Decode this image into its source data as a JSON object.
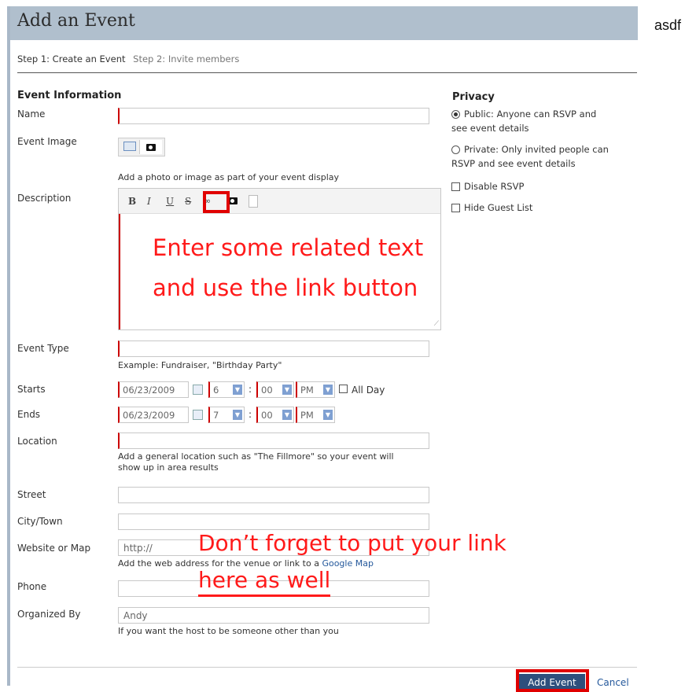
{
  "header": {
    "title": "Add an Event"
  },
  "side_text": "asdf",
  "steps": {
    "step1": "Step 1: Create an Event",
    "step2": "Step 2: Invite members"
  },
  "section": "Event Information",
  "fields": {
    "name": {
      "label": "Name",
      "value": ""
    },
    "event_image": {
      "label": "Event Image",
      "help": "Add a photo or image as part of your event display"
    },
    "description": {
      "label": "Description"
    },
    "event_type": {
      "label": "Event Type",
      "help": "Example: Fundraiser, \"Birthday Party\""
    },
    "starts": {
      "label": "Starts",
      "date": "06/23/2009",
      "hour": "6",
      "minute": "00",
      "ampm": "PM",
      "all_day": "All Day"
    },
    "ends": {
      "label": "Ends",
      "date": "06/23/2009",
      "hour": "7",
      "minute": "00",
      "ampm": "PM"
    },
    "location": {
      "label": "Location",
      "help_line1": "Add a general location such as \"The Fillmore\" so your event will",
      "help_line2": "show up in area results"
    },
    "street": {
      "label": "Street"
    },
    "city": {
      "label": "City/Town"
    },
    "website": {
      "label": "Website or Map",
      "value": "http://",
      "help": "Add the web address for the venue or link to a",
      "help_link": "Google Map"
    },
    "phone": {
      "label": "Phone"
    },
    "organized_by": {
      "label": "Organized By",
      "value": "Andy",
      "help": "If you want the host to be someone other than you"
    }
  },
  "toolbar": {
    "bold": "B",
    "italic": "I",
    "underline": "U",
    "strike": "S"
  },
  "privacy": {
    "title": "Privacy",
    "public_line1": "Public: Anyone can RSVP and",
    "public_line2": "see event details",
    "private_line1": "Private: Only invited people can",
    "private_line2": "RSVP and see event details",
    "disable_rsvp": "Disable RSVP",
    "hide_guest_list": "Hide Guest List"
  },
  "annotations": {
    "editor_line1": "Enter some related text",
    "editor_line2": "and use the link button",
    "website_line1": "Don’t forget to put your link",
    "website_line2": "here as well"
  },
  "buttons": {
    "add_event": "Add Event",
    "cancel": "Cancel"
  },
  "colors": {
    "header_bg": "#b0bfcd",
    "required_border": "#cc0000",
    "annotation": "#ff1a1a",
    "primary_button": "#2e4f7c",
    "link": "#24589b"
  }
}
